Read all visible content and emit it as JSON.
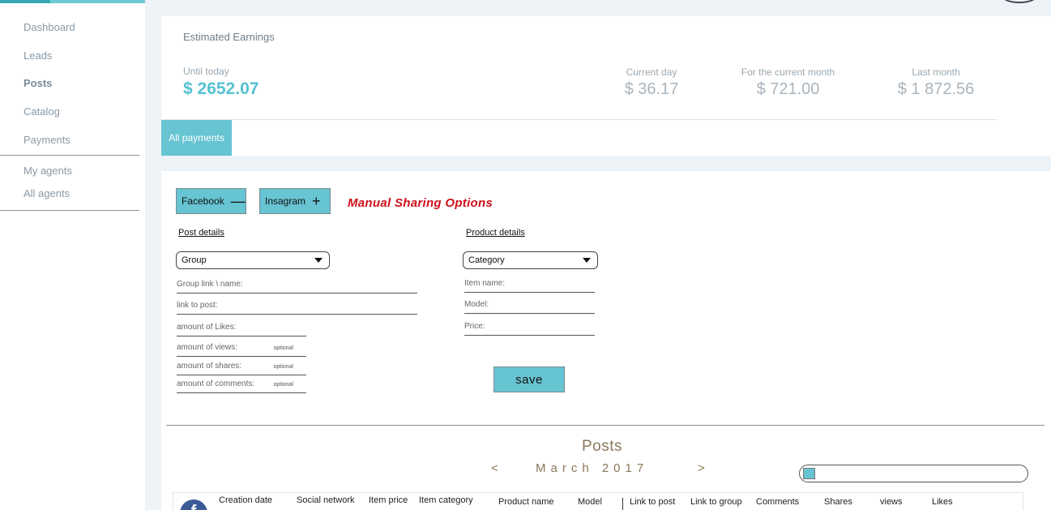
{
  "sidebar": {
    "items": [
      {
        "label": "Dashboard"
      },
      {
        "label": "Leads"
      },
      {
        "label": "Posts"
      },
      {
        "label": "Catalog"
      },
      {
        "label": "Payments"
      },
      {
        "label": "My agents"
      },
      {
        "label": "All agents"
      }
    ],
    "active_item": "Posts",
    "accent_color": "#35a8b6"
  },
  "earnings": {
    "title": "Estimated Earnings",
    "until_today_label": "Until today",
    "until_today_value": "$ 2652.07",
    "current_day_label": "Current day",
    "current_day_value": "$ 36.17",
    "current_month_label": "For the current month",
    "current_month_value": "$ 721.00",
    "last_month_label": "Last month",
    "last_month_value": "$ 1 872.56",
    "tab_label": "All payments"
  },
  "sharing": {
    "facebook_label": "Facebook",
    "facebook_symbol": "—",
    "instagram_label": "Insagram",
    "instagram_symbol": "+",
    "manual_title": "Manual Sharing Options",
    "button_color": "#67c4d2",
    "title_color": "#d0101a"
  },
  "post_details": {
    "title": "Post details",
    "group_select": "Group",
    "group_link_label": "Group link \\ name:",
    "link_to_post_label": "link to post:",
    "likes_label": "amount of Likes:",
    "views_label": "amount of views:",
    "shares_label": "amount of shares:",
    "comments_label": "amount of comments:",
    "optional_label": "optional"
  },
  "product_details": {
    "title": "Product details",
    "category_select": "Category",
    "item_name_label": "Item name:",
    "model_label": "Model:",
    "price_label": "Price:"
  },
  "save_label": "save",
  "posts": {
    "title": "Posts",
    "prev": "<",
    "next": ">",
    "month": "March 2017",
    "columns": [
      "Creation date",
      "Social network",
      "Item price",
      "Item category",
      "Product name",
      "Model",
      "Link to post",
      "Link to group",
      "Comments",
      "Shares",
      "views",
      "Likes"
    ],
    "fb_icon": "f"
  }
}
